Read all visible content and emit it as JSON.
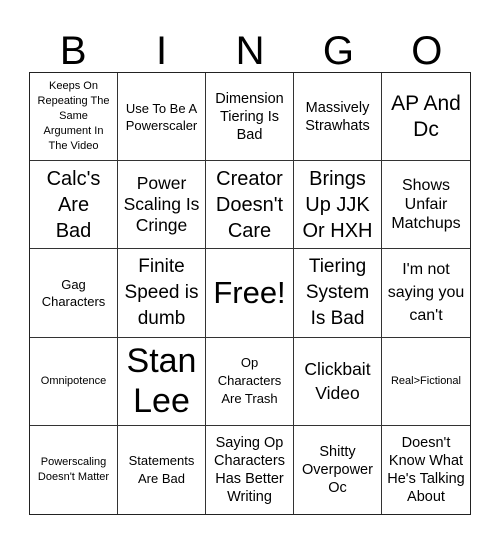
{
  "header": [
    "B",
    "I",
    "N",
    "G",
    "O"
  ],
  "cells": [
    "Keeps On Repeating The Same Argument In The Video",
    "Use To Be A Powerscaler",
    "Dimension Tiering Is Bad",
    "Massively Strawhats",
    "AP And Dc",
    "Calc's Are Bad",
    "Power Scaling Is Cringe",
    "Creator Doesn't Care",
    "Brings Up JJK Or HXH",
    "Shows Unfair Matchups",
    "Gag Characters",
    "Finite Speed is dumb",
    "Free!",
    "Tiering System Is Bad",
    "I'm not saying you can't",
    "Omnipotence",
    "Stan Lee",
    "Op Characters Are Trash",
    "Clickbait Video",
    "Real>Fictional",
    "Powerscaling Doesn't Matter",
    "Statements Are Bad",
    "Saying Op Characters Has Better Writing",
    "Shitty Overpower Oc",
    "Doesn't Know What He's Talking About"
  ]
}
